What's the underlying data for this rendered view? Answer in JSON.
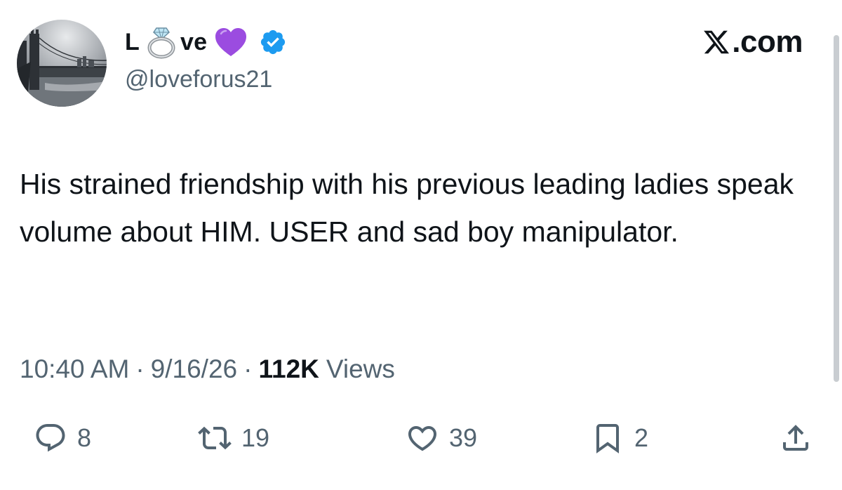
{
  "user": {
    "display_name_start": "L",
    "display_name_end": "ve",
    "display_name_emojis": [
      "ring-icon",
      "purple-heart-icon"
    ],
    "verified": true,
    "handle": "@loveforus21",
    "avatar": "bridge-skyline-avatar"
  },
  "brand": {
    "label": ".com",
    "logo": "x-logo-icon"
  },
  "tweet": {
    "text": "His strained friendship with his previous leading ladies speak volume about HIM. USER and sad boy manipulator."
  },
  "meta": {
    "time": "10:40 AM",
    "separator": "·",
    "date": "9/16/26",
    "views_count": "112K",
    "views_label": "Views"
  },
  "actions": {
    "reply": "8",
    "retweet": "19",
    "like": "39",
    "bookmark": "2"
  },
  "colors": {
    "text": "#0f1419",
    "secondary": "#536471",
    "verified": "#1d9bf0",
    "heart": "#9b4ce0"
  }
}
